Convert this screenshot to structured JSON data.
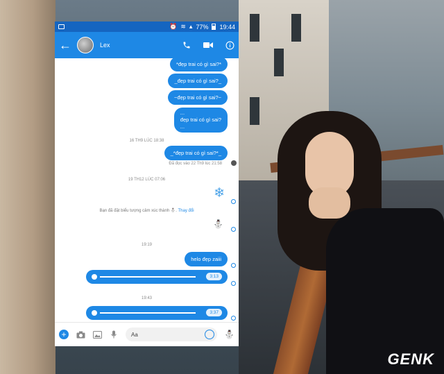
{
  "status_bar": {
    "battery": "77%",
    "time": "19:44"
  },
  "header": {
    "contact_name": "Lex"
  },
  "messages": [
    {
      "text": "*đẹp trai có gì sai?*"
    },
    {
      "text": "_đẹp trai có gì sai?_"
    },
    {
      "text": "~đẹp trai có gì sai?~"
    },
    {
      "text_lines": [
        "...",
        "đẹp trai có gì sai?",
        "..."
      ]
    }
  ],
  "timestamp_1": "16 TH9 LÚC 18:38",
  "message_5": "_*đẹp trai có gì sai?*_",
  "seen_text": "Đã đọc vào 22 Th9 lúc 21:58",
  "timestamp_2": "19 TH12 LÚC 07:06",
  "notice": {
    "text": "Bạn đã đặt biểu tượng cảm xúc thành ⛄.",
    "change_link": "Thay đổi"
  },
  "timestamp_3": "19:19",
  "message_hello": "helo đẹp zaiii",
  "voice_1_duration": "3:13",
  "timestamp_4": "19:43",
  "voice_2_duration": "3:37",
  "composer": {
    "placeholder": "Aa"
  },
  "watermark": "GENK",
  "colors": {
    "accent": "#1e88e5",
    "statusbar": "#1565c0"
  }
}
